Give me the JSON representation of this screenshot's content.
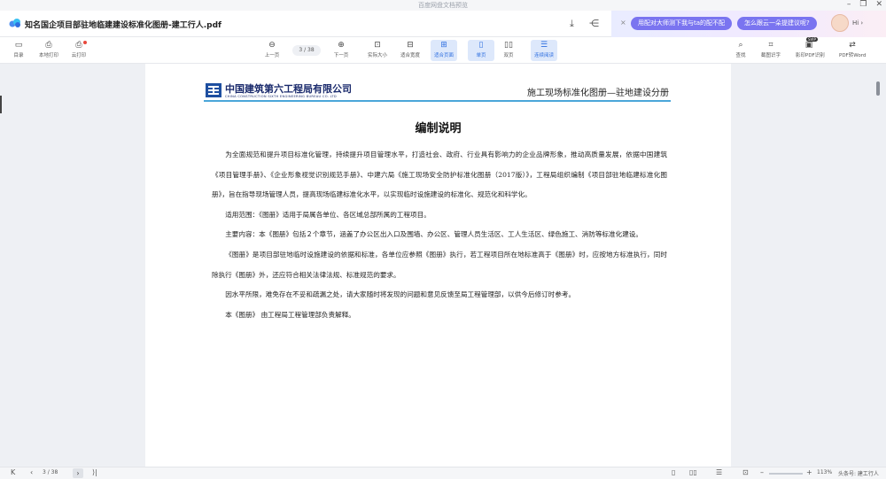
{
  "window": {
    "app_title": "百度网盘文档预览",
    "minimize": "–",
    "restore": "❐",
    "close": "✕"
  },
  "docbar": {
    "file_name": "知名国企项目部驻地临建建设标准化图册-建工行人.pdf",
    "icons": [
      "cloud-logo-icon",
      "download-icon",
      "share-icon"
    ],
    "assistant": {
      "close": "×",
      "suggestion1": "用配对大师测下我与ta的配不配",
      "suggestion2": "怎么跟云一朵提建议呢?",
      "greeting": "Hi ›"
    }
  },
  "toolbar": {
    "left": [
      {
        "label": "目录",
        "icon": "▭"
      },
      {
        "label": "本地打印",
        "icon": "⎙"
      },
      {
        "label": "云打印",
        "icon": "⎙"
      }
    ],
    "prev_label": "上一页",
    "page_indicator": "3 / 38",
    "next_label": "下一页",
    "view": [
      {
        "label": "实际大小",
        "icon": "⊡"
      },
      {
        "label": "适合宽度",
        "icon": "⊟"
      },
      {
        "label": "适合页面",
        "icon": "⊞"
      },
      {
        "label": "单页",
        "icon": "▯"
      },
      {
        "label": "双页",
        "icon": "▯▯"
      },
      {
        "label": "连续阅读",
        "icon": "☰"
      }
    ],
    "right": [
      {
        "label": "查找",
        "icon": "⌕"
      },
      {
        "label": "截图识字",
        "icon": "⌗"
      },
      {
        "label": "影印PDF识别",
        "icon": "▣"
      },
      {
        "label": "PDF转Word",
        "icon": "⇄"
      }
    ],
    "super_tag": "SVIP"
  },
  "page": {
    "company_cn": "中国建筑第六工程局有限公司",
    "company_en": "CHINA CONSTRUCTION SIXTH ENGINEERING BUREAU CO. LTD",
    "doc_category": "施工现场标准化图册—驻地建设分册",
    "heading": "编制说明",
    "paragraphs": [
      "为全面规范和提升项目标准化管理，持续提升项目管理水平，打造社会、政府、行业具有影响力的企业品牌形象，推动高质量发展，依据中国建筑《项目管理手册》、《企业形象视觉识别规范手册》、中建六局《施工现场安全防护标准化图册（2017版）》，工程局组织编制《项目部驻地临建标准化图册》，旨在指导现场管理人员，提高现场临建标准化水平，以实现临时设施建设的标准化、规范化和科学化。",
      "适用范围：《图册》适用于局属各单位、各区域总部所属的工程项目。",
      "主要内容：本《图册》包括２个章节，涵盖了办公区出入口及围墙、办公区、管理人员生活区、工人生活区、绿色施工、消防等标准化建设。",
      "《图册》是项目部驻地临时设施建设的依据和标准，各单位应参照《图册》执行，若工程项目所在地标准高于《图册》时，应按地方标准执行，同时除执行《图册》外，还应符合相关法律法规、标准规范的要求。",
      "因水平所限，难免存在不妥和疏漏之处，请大家随时将发现的问题和意见反馈至局工程管理部，以供今后修订时参考。",
      "本《图册》 由工程局工程管理部负责解释。"
    ]
  },
  "statusbar": {
    "first": "K",
    "prev": "‹",
    "page_indicator": "3 / 38",
    "next": "›",
    "last": "⟩|",
    "zoom_out": "–",
    "zoom_in": "+",
    "zoom_level": "113%",
    "watermark": "头条号: 建工行人"
  },
  "colors": {
    "accent": "#2f6fe0",
    "rule": "#4aa6d9",
    "brand_text": "#1a2a6c",
    "pill": "#7a74f0"
  }
}
